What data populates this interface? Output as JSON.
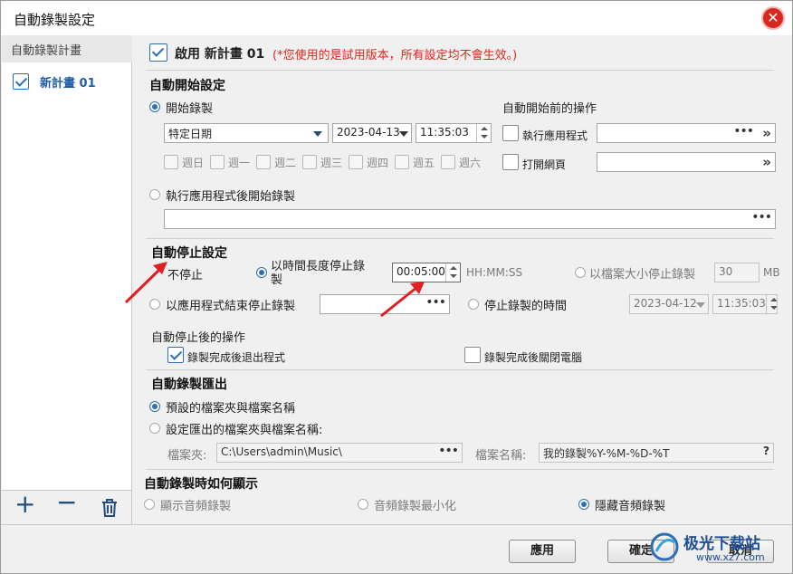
{
  "window": {
    "title": "自動錄製設定"
  },
  "sidebar": {
    "header": "自動錄製計畫",
    "items": [
      {
        "label": "新計畫 01",
        "checked": true
      }
    ],
    "add_icon": "plus-icon",
    "remove_icon": "minus-icon",
    "delete_icon": "trash-icon"
  },
  "enable": {
    "label": "啟用 新計畫 01",
    "notice": "(*您使用的是試用版本，所有設定均不會生效。)"
  },
  "auto_start": {
    "title": "自動開始設定",
    "start_record_label": "開始錄製",
    "mode_value": "特定日期",
    "date_value": "2023-04-13",
    "time_value": "11:35:03",
    "weekdays": [
      "週日",
      "週一",
      "週二",
      "週三",
      "週四",
      "週五",
      "週六"
    ],
    "after_app_label": "執行應用程式後開始錄製",
    "pre_actions_title": "自動開始前的操作",
    "run_app_label": "執行應用程式",
    "open_web_label": "打開網頁"
  },
  "auto_stop": {
    "title": "自動停止設定",
    "no_stop_label": "不停止",
    "by_duration_label_1": "以時間長度停止錄",
    "by_duration_label_2": "製",
    "duration_value": "00:05:00",
    "duration_format": "HH:MM:SS",
    "by_size_label": "以檔案大小停止錄製",
    "size_value": "30",
    "size_unit": "MB",
    "by_app_end_label": "以應用程式結束停止錄製",
    "stop_time_label": "停止錄製的時間",
    "stop_date_value": "2023-04-12",
    "stop_time_value": "11:35:03",
    "after_title": "自動停止後的操作",
    "exit_app_label": "錄製完成後退出程式",
    "exit_app_checked": true,
    "shutdown_label": "錄製完成後關閉電腦"
  },
  "export": {
    "title": "自動錄製匯出",
    "default_label": "預設的檔案夾與檔案名稱",
    "custom_label": "設定匯出的檔案夾與檔案名稱:",
    "folder_label": "檔案夾:",
    "folder_value": "C:\\Users\\admin\\Music\\",
    "filename_label": "檔案名稱:",
    "filename_value": "我的錄製%Y-%M-%D-%T"
  },
  "display": {
    "title": "自動錄製時如何顯示",
    "show_audio_label": "顯示音頻錄製",
    "minimize_label": "音頻錄製最小化",
    "hide_label": "隱藏音頻錄製"
  },
  "footer": {
    "apply_label": "應用",
    "ok_label": "確定",
    "cancel_label": "取消"
  },
  "watermark": {
    "text": "极光下载站",
    "url": "www.xz7.com"
  },
  "colors": {
    "accent": "#2d6fb6",
    "notice": "#d9281d",
    "arrow": "#e02020",
    "close": "#d9281d"
  }
}
